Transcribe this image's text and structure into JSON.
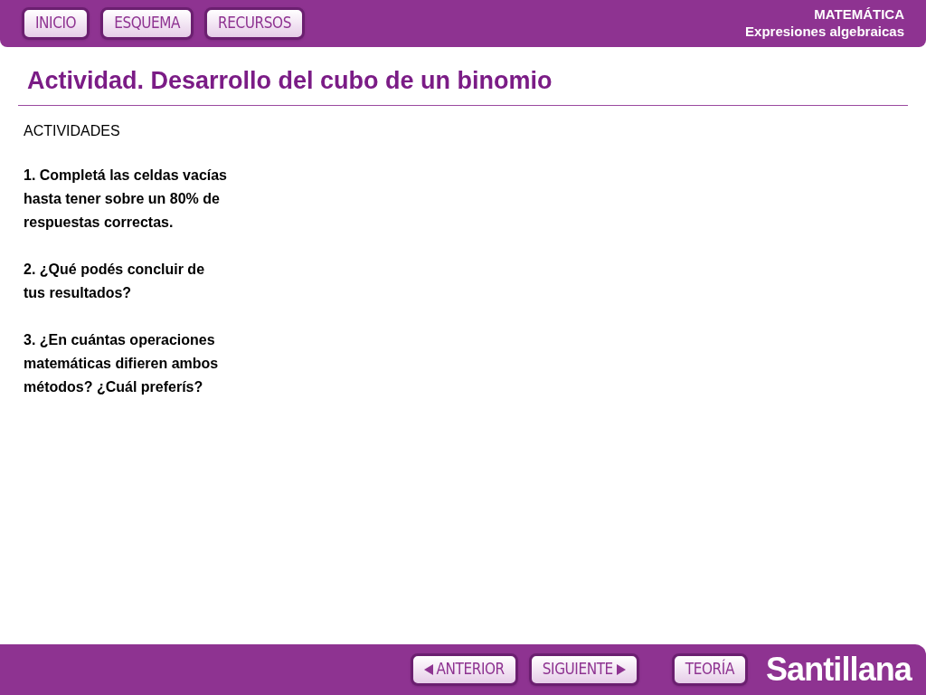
{
  "header": {
    "nav_buttons": [
      {
        "label": "INICIO"
      },
      {
        "label": "ESQUEMA"
      },
      {
        "label": "RECURSOS"
      }
    ],
    "subject": "MATEMÁTICA",
    "topic": "Expresiones algebraicas"
  },
  "title": "Actividad. Desarrollo del cubo de un binomio",
  "content": {
    "heading": "ACTIVIDADES",
    "items": [
      "1. Completá las celdas vacías\nhasta tener sobre un 80% de\nrespuestas correctas.",
      "2. ¿Qué podés concluir de\ntus resultados?",
      "3. ¿En cuántas operaciones\nmatemáticas difieren ambos\nmétodos? ¿Cuál preferís?"
    ]
  },
  "footer": {
    "buttons": [
      {
        "label": "ANTERIOR",
        "kind": "prev"
      },
      {
        "label": "SIGUIENTE",
        "kind": "next"
      },
      {
        "label": "TEORÍA",
        "kind": "plain"
      }
    ],
    "brand": "Santillana"
  }
}
